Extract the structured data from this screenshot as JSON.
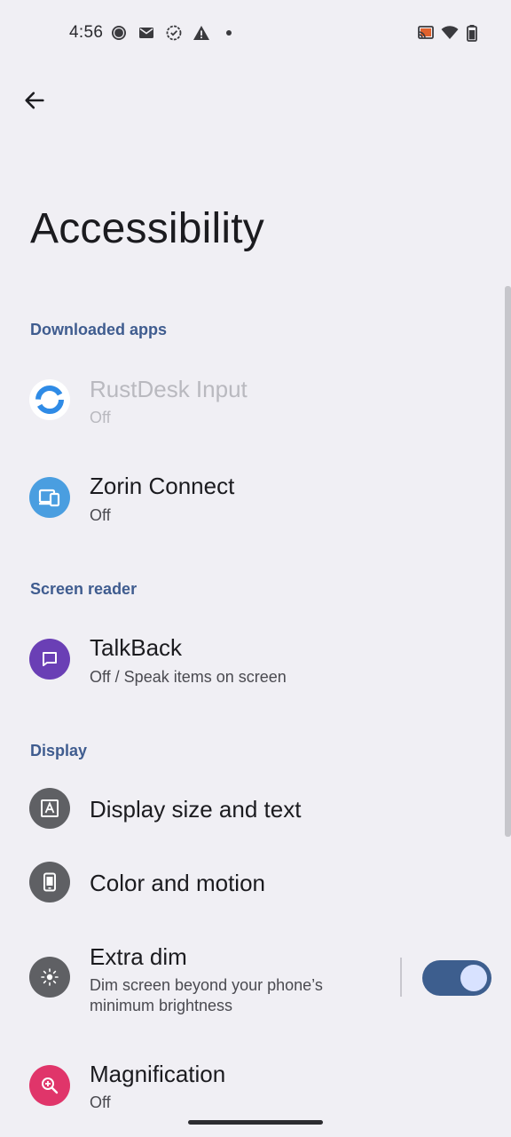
{
  "status_bar": {
    "time": "4:56",
    "left_icons": [
      "chat-bubble-icon",
      "mail-icon",
      "gear-badge-icon",
      "warning-icon",
      "dot-icon"
    ],
    "right_icons": [
      "cast-icon",
      "wifi-icon",
      "battery-icon"
    ]
  },
  "header": {
    "back_icon": "arrow-back-icon",
    "title": "Accessibility"
  },
  "sections": {
    "downloaded_apps": "Downloaded apps",
    "screen_reader": "Screen reader",
    "display": "Display"
  },
  "items": {
    "rustdesk": {
      "title": "RustDesk Input",
      "subtitle": "Off"
    },
    "zorin": {
      "title": "Zorin Connect",
      "subtitle": "Off"
    },
    "talkback": {
      "title": "TalkBack",
      "subtitle": "Off / Speak items on screen"
    },
    "display_size": {
      "title": "Display size and text"
    },
    "color_motion": {
      "title": "Color and motion"
    },
    "extra_dim": {
      "title": "Extra dim",
      "subtitle": "Dim screen beyond your phone’s minimum brightness",
      "toggle_on": true
    },
    "magnification": {
      "title": "Magnification",
      "subtitle": "Off"
    }
  },
  "colors": {
    "accent": "#3f5c8f",
    "toggle_track": "#3d5e8e",
    "talkback_icon_bg": "#6a3fb5",
    "zorin_icon_bg": "#4a9ee0",
    "magnification_icon_bg": "#e0356a",
    "display_icon_bg": "#5f6064"
  }
}
